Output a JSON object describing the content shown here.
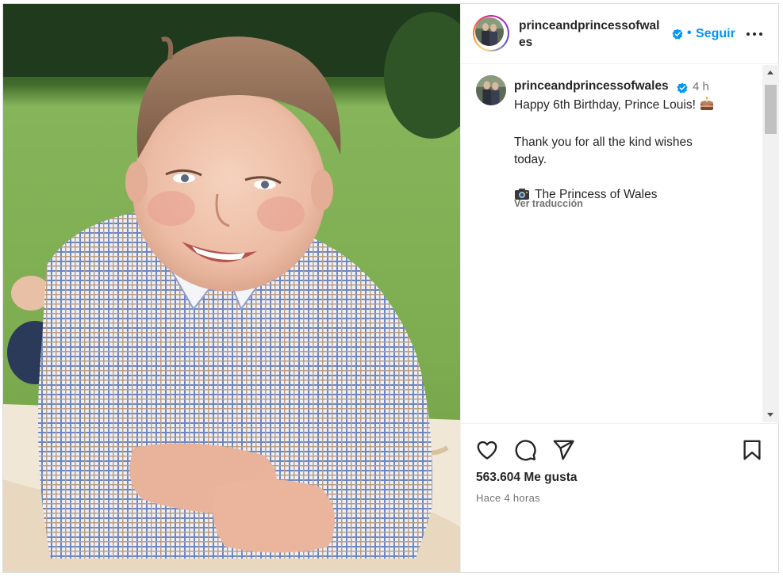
{
  "post": {
    "username": "princeandprincessofwales",
    "header_username_line1": "princeandprincessofwal",
    "header_username_line2": "es",
    "separator": "•",
    "follow_label": "Seguir",
    "caption_time": "4 h",
    "caption_lines": [
      "Happy 6th Birthday, Prince Louis!",
      "",
      "Thank you for all the kind wishes",
      "today.",
      "",
      "The Princess of Wales"
    ],
    "translate_label": "Ver traducción",
    "likes": "563.604 Me gusta",
    "posted": "Hace 4 horas"
  },
  "icons": {
    "verified": "verified-badge-icon",
    "more": "more-options-icon",
    "like": "heart-icon",
    "comment": "comment-icon",
    "share": "paper-plane-icon",
    "save": "bookmark-icon",
    "cake": "birthday-cake-emoji",
    "camera": "camera-emoji"
  },
  "colors": {
    "accent": "#0095f6",
    "text": "#262626",
    "muted": "#737373",
    "border": "#dbdbdb"
  }
}
